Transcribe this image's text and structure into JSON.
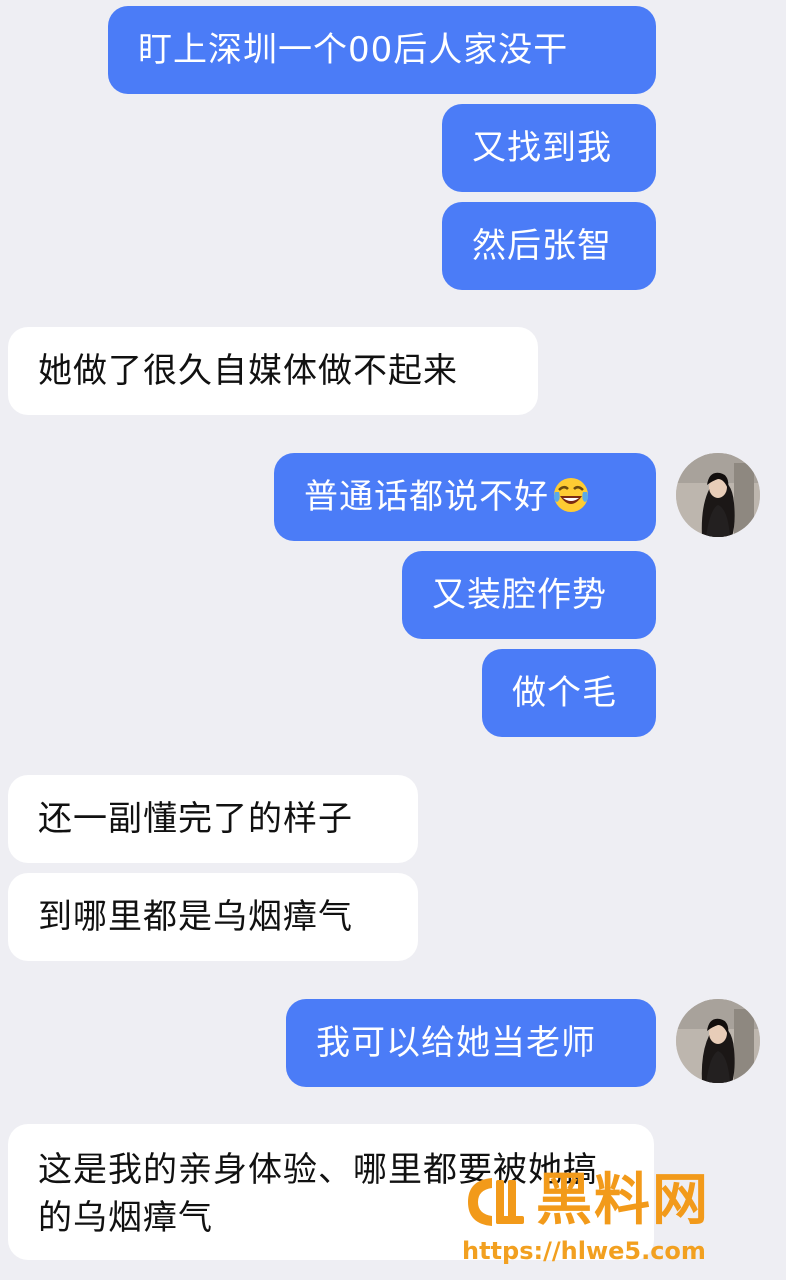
{
  "messages": [
    {
      "id": "m1",
      "text": "盯上深圳一个00后人家没干"
    },
    {
      "id": "m2",
      "text": "又找到我"
    },
    {
      "id": "m3",
      "text": "然后张智"
    },
    {
      "id": "m4",
      "text": "她做了很久自媒体做不起来"
    },
    {
      "id": "m5",
      "text": "普通话都说不好",
      "emoji": "face-with-tears-of-joy"
    },
    {
      "id": "m6",
      "text": "又装腔作势"
    },
    {
      "id": "m7",
      "text": "做个毛"
    },
    {
      "id": "m8",
      "text": "还一副懂完了的样子"
    },
    {
      "id": "m9",
      "text": "到哪里都是乌烟瘴气"
    },
    {
      "id": "m10",
      "text": "我可以给她当老师"
    },
    {
      "id": "m11",
      "text": "这是我的亲身体验、哪里都要被她搞的乌烟瘴气"
    }
  ],
  "watermark": {
    "title": "黑料网",
    "url": "https://hlwe5.com"
  },
  "colors": {
    "outgoing_bubble": "#4b7cf7",
    "incoming_bubble": "#ffffff",
    "background": "#eeeef3",
    "watermark": "#f29a1a"
  }
}
